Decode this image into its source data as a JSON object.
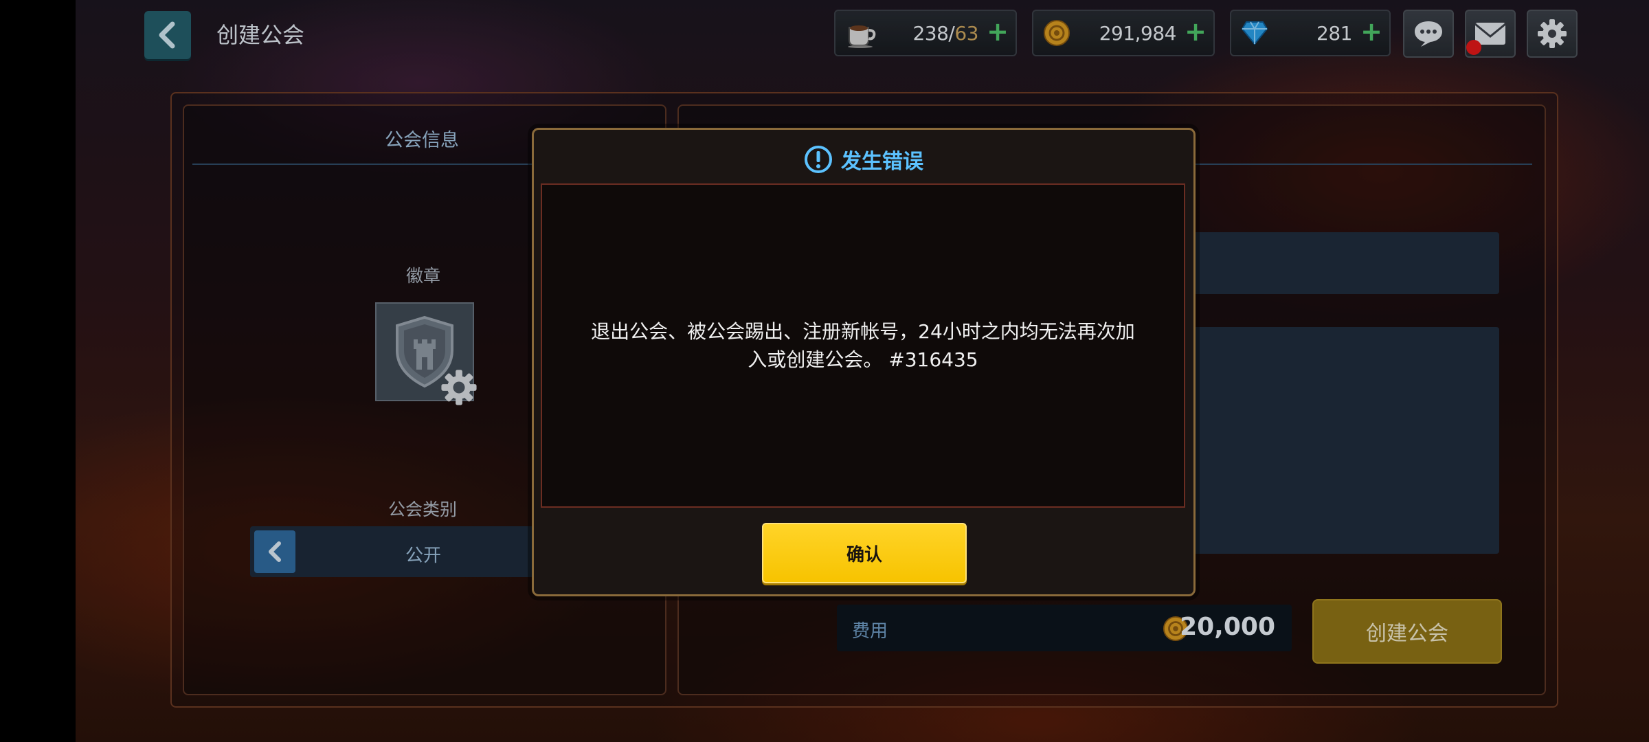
{
  "header": {
    "title": "创建公会",
    "stamina": {
      "current": "238/",
      "max": "63"
    },
    "gold": "291,984",
    "gems": "281",
    "plus_glyph": "+"
  },
  "left_panel": {
    "heading": "公会信息",
    "emblem_label": "徽章",
    "category_label": "公会类别",
    "category_value": "公开"
  },
  "right_panel": {
    "cost_label": "费用",
    "cost_value": "20,000",
    "create_button": "创建公会"
  },
  "dialog": {
    "title": "发生错误",
    "message": "退出公会、被公会踢出、注册新帐号，24小时之内均无法再次加入或创建公会。 #316435",
    "confirm_button": "确认"
  },
  "colors": {
    "accent_blue": "#5cc2ff",
    "confirm_yellow": "#ffd428",
    "plus_green": "#4ec36a",
    "notification_red": "#e01818"
  }
}
